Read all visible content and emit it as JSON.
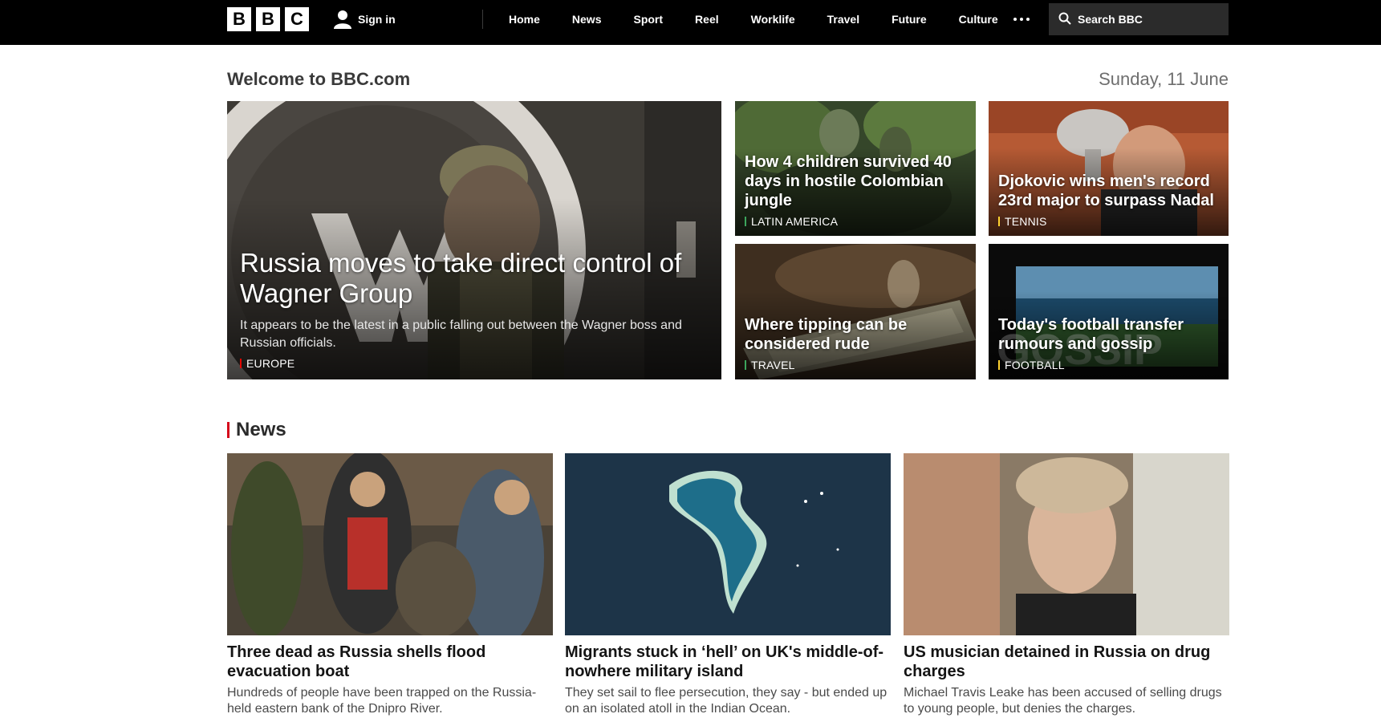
{
  "nav": {
    "logo_letters": [
      "B",
      "B",
      "C"
    ],
    "signin": "Sign in",
    "links": [
      "Home",
      "News",
      "Sport",
      "Reel",
      "Worklife",
      "Travel",
      "Future",
      "Culture"
    ],
    "search_placeholder": "Search BBC"
  },
  "welcome": {
    "title": "Welcome to BBC.com",
    "date": "Sunday, 11 June"
  },
  "hero": {
    "title": "Russia moves to take direct control of Wagner Group",
    "summary": "It appears to be the latest in a public falling out between the Wagner boss and Russian officials.",
    "tag": "EUROPE",
    "tag_color": "#e10600"
  },
  "cards": [
    {
      "title": "How 4 children survived 40 days in hostile Colombian jungle",
      "tag": "LATIN AMERICA",
      "tag_color": "#3ca55c"
    },
    {
      "title": "Djokovic wins men's record 23rd major to surpass Nadal",
      "tag": "TENNIS",
      "tag_color": "#ffd230"
    },
    {
      "title": "Where tipping can be considered rude",
      "tag": "TRAVEL",
      "tag_color": "#3ca55c"
    },
    {
      "title": "Today's football transfer rumours and gossip",
      "tag": "FOOTBALL",
      "tag_color": "#ffd230"
    }
  ],
  "news_section": {
    "label": "News",
    "accent": "#d5081b"
  },
  "stories": [
    {
      "title": "Three dead as Russia shells flood evacuation boat",
      "desc": "Hundreds of people have been trapped on the Russia-held eastern bank of the Dnipro River."
    },
    {
      "title": "Migrants stuck in ‘hell’ on UK's middle-of-nowhere military island",
      "desc": "They set sail to flee persecution, they say - but ended up on an isolated atoll in the Indian Ocean."
    },
    {
      "title": "US musician detained in Russia on drug charges",
      "desc": "Michael Travis Leake has been accused of selling drugs to young people, but denies the charges."
    }
  ]
}
